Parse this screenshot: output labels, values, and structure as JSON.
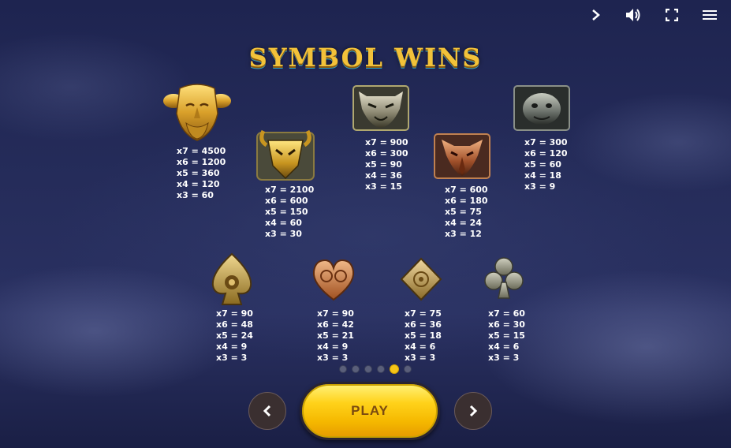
{
  "title": "SYMBOL WINS",
  "top_controls": [
    "forward-icon",
    "sound-icon",
    "fullscreen-icon",
    "menu-icon"
  ],
  "symbols": [
    {
      "name": "golden-god-mask",
      "pays": [
        "x7 = 4500",
        "x6 = 1200",
        "x5 = 360",
        "x4 = 120",
        "x3 = 60"
      ]
    },
    {
      "name": "golden-ram-helmet",
      "pays": [
        "x7 = 2100",
        "x6 = 600",
        "x5 = 150",
        "x4 = 60",
        "x3 = 30"
      ]
    },
    {
      "name": "silver-lion-mask",
      "pays": [
        "x7 = 900",
        "x6 = 300",
        "x5 = 90",
        "x4 = 36",
        "x3 = 15"
      ]
    },
    {
      "name": "bronze-eagle-mask",
      "pays": [
        "x7 = 600",
        "x6 = 180",
        "x5 = 75",
        "x4 = 24",
        "x3 = 12"
      ]
    },
    {
      "name": "stone-gargoyle-mask",
      "pays": [
        "x7 = 300",
        "x6 = 120",
        "x5 = 60",
        "x4 = 18",
        "x3 = 9"
      ]
    },
    {
      "name": "spade",
      "pays": [
        "x7 = 90",
        "x6 = 48",
        "x5 = 24",
        "x4 = 9",
        "x3 = 3"
      ]
    },
    {
      "name": "heart",
      "pays": [
        "x7 = 90",
        "x6 = 42",
        "x5 = 21",
        "x4 = 9",
        "x3 = 3"
      ]
    },
    {
      "name": "diamond",
      "pays": [
        "x7 = 75",
        "x6 = 36",
        "x5 = 18",
        "x4 = 6",
        "x3 = 3"
      ]
    },
    {
      "name": "club",
      "pays": [
        "x7 = 60",
        "x6 = 30",
        "x5 = 15",
        "x4 = 6",
        "x3 = 3"
      ]
    }
  ],
  "pager": {
    "total": 6,
    "current": 5
  },
  "controls": {
    "play_label": "PLAY",
    "prev_icon": "chevron-left-icon",
    "next_icon": "chevron-right-icon"
  },
  "colors": {
    "accent": "#f5c518",
    "title": "#f2c23a",
    "text": "#ffffff"
  }
}
